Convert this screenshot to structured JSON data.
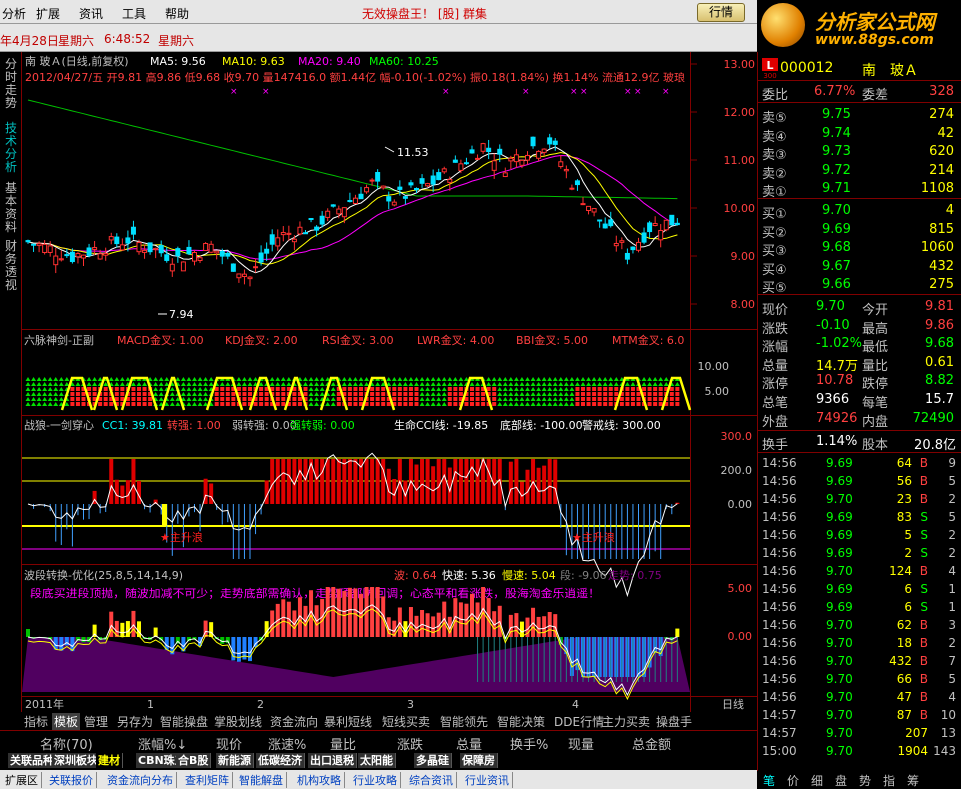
{
  "menubar": {
    "items": [
      "分析",
      "扩展",
      "资讯",
      "工具",
      "帮助"
    ],
    "alert": "无效操盘王！   [股]   群集",
    "quote_btn": "行情"
  },
  "logo": {
    "title": "分析家公式网",
    "url": "www.88gs.com"
  },
  "datebar": {
    "date": "年4月28日",
    "weekday1": "星期六",
    "time": "6:48:52",
    "weekday2": "星期六"
  },
  "vtabs": [
    "分时走势",
    "技术分析",
    "基本资料",
    "财务透视"
  ],
  "main_panel": {
    "title": "南  玻Ａ(日线,前复权)",
    "ma": [
      {
        "label": "MA5: 9.56",
        "color": "#ffffff"
      },
      {
        "label": "MA10: 9.63",
        "color": "#ffff00"
      },
      {
        "label": "MA20: 9.40",
        "color": "#ff00ff"
      },
      {
        "label": "MA60: 10.25",
        "color": "#00ff00"
      }
    ],
    "info_line": "2012/04/27/五  开9.81  高9.86  低9.68  收9.70  量147416.0  额1.44亿  幅-0.10(-1.02%)  振0.18(1.84%)  换1.14%  流通12.9亿  玻琅",
    "high_mark": "11.53",
    "low_mark": "7.94",
    "y_ticks": [
      "13.00",
      "12.00",
      "11.00",
      "10.00",
      "9.00",
      "8.00"
    ]
  },
  "indicator1": {
    "title": "六脉神剑-正副",
    "labels": [
      "MACD金叉: 1.00",
      "KDJ金叉: 2.00",
      "RSI金叉: 3.00",
      "LWR金叉: 4.00",
      "BBI金叉: 5.00",
      "MTM金叉: 6.0"
    ],
    "y_ticks": [
      "10.00",
      "5.00"
    ]
  },
  "indicator2": {
    "title": "战狼-一剑穿心",
    "labels": [
      {
        "text": "CC1: 39.81",
        "color": "#00ffff"
      },
      {
        "text": "转强: 1.00",
        "color": "#ff4040"
      },
      {
        "text": "弱转强: 0.00",
        "color": "#c0c0c0"
      },
      {
        "text": "强转弱: 0.00",
        "color": "#00ff00"
      },
      {
        "text": "生命CCI线: -19.85",
        "color": "#ffffff"
      },
      {
        "text": "底部线: -100.00",
        "color": "#ffffff"
      },
      {
        "text": "警戒线: 300.00",
        "color": "#ffffff"
      }
    ],
    "markers": [
      "★主升浪",
      "★主升浪"
    ],
    "y_ticks": [
      "300.0",
      "200.0",
      "0.00"
    ]
  },
  "indicator3": {
    "title": "波段转换-优化(25,8,5,14,14,9)",
    "labels": [
      {
        "text": "波: 0.64",
        "color": "#ff4040"
      },
      {
        "text": "快速: 5.36",
        "color": "#ffffff"
      },
      {
        "text": "慢速: 5.04",
        "color": "#ffff00"
      },
      {
        "text": "段: -9.06",
        "color": "#808080"
      },
      {
        "text": "走势: 0.75",
        "color": "#800080"
      }
    ],
    "scroll_text": "段底买进段顶抛，随波加减不可少；走势底部需确认，走势顶部防回调；心态平和看涨跌，股海淘金乐逍遥！",
    "y_ticks": [
      "5.00",
      "0.00"
    ]
  },
  "x_axis": {
    "labels": [
      "2011年",
      "1",
      "2",
      "3",
      "4"
    ],
    "period": "日线"
  },
  "tabs1": [
    "指标",
    "模板",
    "管理",
    "另存为",
    "智能操盘",
    "掌股划线",
    "资金流向",
    "暴利短线",
    "短线买卖",
    "智能领先",
    "智能决策",
    "DDE行情",
    "主力买卖",
    "操盘手"
  ],
  "tabs1_active": "模板",
  "header2": [
    "名称(70)",
    "涨幅%↓",
    "现价",
    "涨速%",
    "量比",
    "涨跌",
    "总量",
    "换手%",
    "现量",
    "总金额"
  ],
  "tabs3": [
    "关联品种",
    "深圳板块",
    "建材",
    "CBN珠三",
    "合B股",
    "新能源",
    "低碳经济",
    "出口退税",
    "太阳能",
    "多晶硅",
    "保障房"
  ],
  "tabs3_active": "建材",
  "tabs4": [
    "扩展区",
    "关联报价",
    "资金流向分布",
    "查利矩阵",
    "智能解盘",
    "机构攻略",
    "行业攻略",
    "综合资讯",
    "行业资讯"
  ],
  "quote": {
    "code": "000012",
    "name": "南　玻Ａ",
    "weibi_label": "委比",
    "weibi": "6.77%",
    "weicha_label": "委差",
    "weicha": "328",
    "sells": [
      {
        "label": "卖⑤",
        "price": "9.75",
        "vol": "274"
      },
      {
        "label": "卖④",
        "price": "9.74",
        "vol": "42"
      },
      {
        "label": "卖③",
        "price": "9.73",
        "vol": "620"
      },
      {
        "label": "卖②",
        "price": "9.72",
        "vol": "214"
      },
      {
        "label": "卖①",
        "price": "9.71",
        "vol": "1108"
      }
    ],
    "buys": [
      {
        "label": "买①",
        "price": "9.70",
        "vol": "4"
      },
      {
        "label": "买②",
        "price": "9.69",
        "vol": "815"
      },
      {
        "label": "买③",
        "price": "9.68",
        "vol": "1060"
      },
      {
        "label": "买④",
        "price": "9.67",
        "vol": "432"
      },
      {
        "label": "买⑤",
        "price": "9.66",
        "vol": "275"
      }
    ],
    "stats": [
      {
        "l1": "现价",
        "v1": "9.70",
        "c1": "#00ff00",
        "l2": "今开",
        "v2": "9.81",
        "c2": "#ff4040"
      },
      {
        "l1": "涨跌",
        "v1": "-0.10",
        "c1": "#00ff00",
        "l2": "最高",
        "v2": "9.86",
        "c2": "#ff4040"
      },
      {
        "l1": "涨幅",
        "v1": "-1.02%",
        "c1": "#00ff00",
        "l2": "最低",
        "v2": "9.68",
        "c2": "#00ff00"
      },
      {
        "l1": "总量",
        "v1": "14.7万",
        "c1": "#ffff00",
        "l2": "量比",
        "v2": "0.61",
        "c2": "#ffff00"
      },
      {
        "l1": "涨停",
        "v1": "10.78",
        "c1": "#ff4040",
        "l2": "跌停",
        "v2": "8.82",
        "c2": "#00ff00"
      },
      {
        "l1": "总笔",
        "v1": "9366",
        "c1": "#ffffff",
        "l2": "每笔",
        "v2": "15.7",
        "c2": "#ffffff"
      },
      {
        "l1": "外盘",
        "v1": "74926",
        "c1": "#ff4040",
        "l2": "内盘",
        "v2": "72490",
        "c2": "#00ff00"
      }
    ],
    "huanshou_label": "换手",
    "huanshou": "1.14%",
    "guben_label": "股本",
    "guben": "20.8亿",
    "ticks": [
      {
        "t": "14:56",
        "p": "9.69",
        "v": "64",
        "d": "B",
        "n": "9"
      },
      {
        "t": "14:56",
        "p": "9.69",
        "v": "56",
        "d": "B",
        "n": "5"
      },
      {
        "t": "14:56",
        "p": "9.70",
        "v": "23",
        "d": "B",
        "n": "2"
      },
      {
        "t": "14:56",
        "p": "9.69",
        "v": "83",
        "d": "S",
        "n": "5"
      },
      {
        "t": "14:56",
        "p": "9.69",
        "v": "5",
        "d": "S",
        "n": "2"
      },
      {
        "t": "14:56",
        "p": "9.69",
        "v": "2",
        "d": "S",
        "n": "2"
      },
      {
        "t": "14:56",
        "p": "9.70",
        "v": "124",
        "d": "B",
        "n": "4"
      },
      {
        "t": "14:56",
        "p": "9.69",
        "v": "6",
        "d": "S",
        "n": "1"
      },
      {
        "t": "14:56",
        "p": "9.69",
        "v": "6",
        "d": "S",
        "n": "1"
      },
      {
        "t": "14:56",
        "p": "9.70",
        "v": "62",
        "d": "B",
        "n": "3"
      },
      {
        "t": "14:56",
        "p": "9.70",
        "v": "18",
        "d": "B",
        "n": "2"
      },
      {
        "t": "14:56",
        "p": "9.70",
        "v": "432",
        "d": "B",
        "n": "7"
      },
      {
        "t": "14:56",
        "p": "9.70",
        "v": "66",
        "d": "B",
        "n": "5"
      },
      {
        "t": "14:56",
        "p": "9.70",
        "v": "47",
        "d": "B",
        "n": "4"
      },
      {
        "t": "14:57",
        "p": "9.70",
        "v": "87",
        "d": "B",
        "n": "10"
      },
      {
        "t": "14:57",
        "p": "9.70",
        "v": "207",
        "d": "",
        "n": "13"
      },
      {
        "t": "15:00",
        "p": "9.70",
        "v": "1904",
        "d": "",
        "n": "143"
      }
    ],
    "bottom_tabs": [
      "笔",
      "价",
      "细",
      "盘",
      "势",
      "指",
      "筹"
    ]
  }
}
